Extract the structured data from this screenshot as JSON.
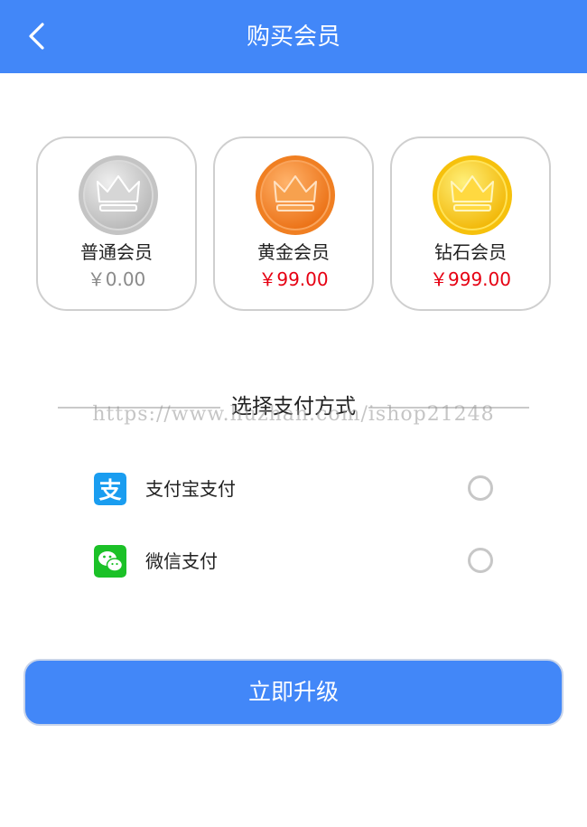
{
  "header": {
    "title": "购买会员"
  },
  "tiers": [
    {
      "name": "普通会员",
      "price": "￥0.00",
      "price_color": "#8a8a8a",
      "medal": "silver-crown-medal"
    },
    {
      "name": "黄金会员",
      "price": "￥99.00",
      "price_color": "#e60012",
      "medal": "orange-crown-medal"
    },
    {
      "name": "钻石会员",
      "price": "￥999.00",
      "price_color": "#e60012",
      "medal": "gold-crown-medal"
    }
  ],
  "payment": {
    "title": "选择支付方式",
    "watermark": "https://www.huzhan.com/ishop21248",
    "methods": [
      {
        "label": "支付宝支付",
        "icon": "alipay-icon",
        "color": "#1a9df0"
      },
      {
        "label": "微信支付",
        "icon": "wechat-icon",
        "color": "#1bc127"
      }
    ]
  },
  "action": {
    "label": "立即升级"
  },
  "colors": {
    "primary": "#4287f8",
    "price_red": "#e60012"
  }
}
